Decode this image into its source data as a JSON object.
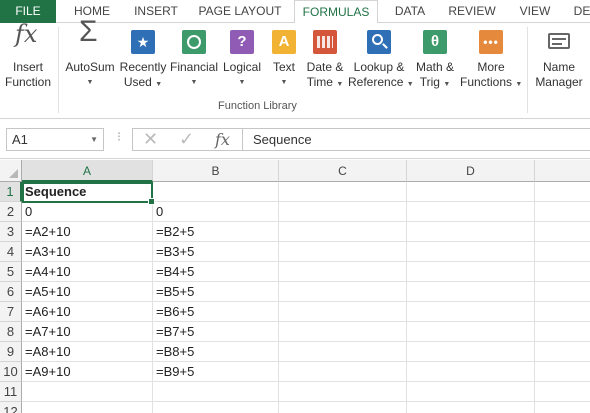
{
  "tabs": [
    {
      "label": "FILE"
    },
    {
      "label": "HOME"
    },
    {
      "label": "INSERT"
    },
    {
      "label": "PAGE LAYOUT"
    },
    {
      "label": "FORMULAS"
    },
    {
      "label": "DATA"
    },
    {
      "label": "REVIEW"
    },
    {
      "label": "VIEW"
    },
    {
      "label": "DE"
    }
  ],
  "ribbon": {
    "insert_function": {
      "line1": "Insert",
      "line2": "Function",
      "glyph": "fx"
    },
    "autosum": {
      "line1": "AutoSum",
      "glyph": "Σ"
    },
    "recently_used": {
      "line1": "Recently",
      "line2": "Used"
    },
    "financial": {
      "line1": "Financial"
    },
    "logical": {
      "line1": "Logical",
      "glyph": "?"
    },
    "text": {
      "line1": "Text",
      "glyph": "A"
    },
    "date_time": {
      "line1": "Date &",
      "line2": "Time"
    },
    "lookup": {
      "line1": "Lookup &",
      "line2": "Reference"
    },
    "math": {
      "line1": "Math &",
      "line2": "Trig",
      "glyph": "θ"
    },
    "more": {
      "line1": "More",
      "line2": "Functions"
    },
    "name_manager": {
      "line1": "Name",
      "line2": "Manager"
    },
    "group_label": "Function Library"
  },
  "formula_bar": {
    "name_box": "A1",
    "fx_glyph": "fx",
    "value": "Sequence"
  },
  "columns": [
    "A",
    "B",
    "C",
    "D"
  ],
  "rows": [
    {
      "num": "1",
      "a": "Sequence",
      "b": ""
    },
    {
      "num": "2",
      "a": "0",
      "b": "0"
    },
    {
      "num": "3",
      "a": "=A2+10",
      "b": "=B2+5"
    },
    {
      "num": "4",
      "a": "=A3+10",
      "b": "=B3+5"
    },
    {
      "num": "5",
      "a": "=A4+10",
      "b": "=B4+5"
    },
    {
      "num": "6",
      "a": "=A5+10",
      "b": "=B5+5"
    },
    {
      "num": "7",
      "a": "=A6+10",
      "b": "=B6+5"
    },
    {
      "num": "8",
      "a": "=A7+10",
      "b": "=B7+5"
    },
    {
      "num": "9",
      "a": "=A8+10",
      "b": "=B8+5"
    },
    {
      "num": "10",
      "a": "=A9+10",
      "b": "=B9+5"
    },
    {
      "num": "11",
      "a": "",
      "b": ""
    },
    {
      "num": "12",
      "a": "",
      "b": ""
    }
  ],
  "colors": {
    "accent": "#217346"
  }
}
